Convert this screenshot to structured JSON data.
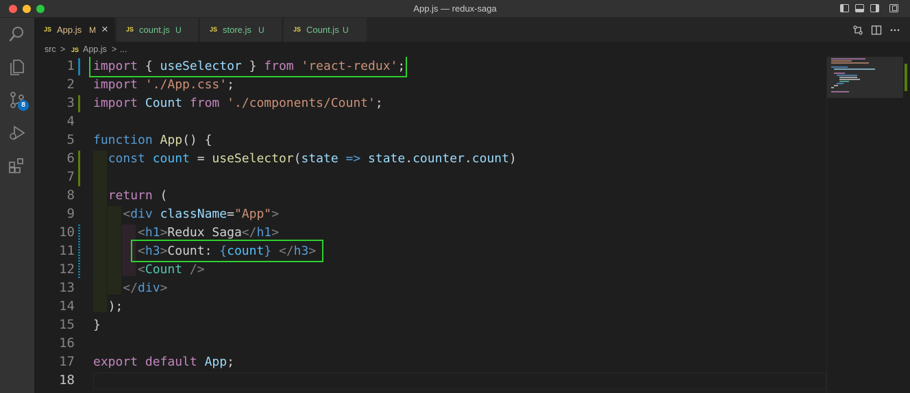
{
  "window": {
    "title": "App.js — redux-saga"
  },
  "tabs": [
    {
      "name": "App.js",
      "badge": "M",
      "close": "×"
    },
    {
      "name": "count.js",
      "badge": "U"
    },
    {
      "name": "store.js",
      "badge": "U"
    },
    {
      "name": "Count.js",
      "badge": "U"
    }
  ],
  "tab_icon_text": "JS",
  "activity": {
    "source_control_badge": "8"
  },
  "breadcrumbs": {
    "folder": "src",
    "sep": ">",
    "file": "App.js",
    "more": "..."
  },
  "editor": {
    "line_numbers": [
      "1",
      "2",
      "3",
      "4",
      "5",
      "6",
      "7",
      "8",
      "9",
      "10",
      "11",
      "12",
      "13",
      "14",
      "15",
      "16",
      "17",
      "18"
    ],
    "code": {
      "l1": {
        "import": "import",
        "brace_open": " { ",
        "ident": "useSelector",
        "brace_close": " } ",
        "from": "from",
        "space": " ",
        "module": "'react-redux'",
        "semi": ";"
      },
      "l2": {
        "import": "import",
        "space": " ",
        "module": "'./App.css'",
        "semi": ";"
      },
      "l3": {
        "import": "import",
        "space1": " ",
        "ident": "Count",
        "space2": " ",
        "from": "from",
        "space3": " ",
        "module": "'./components/Count'",
        "semi": ";"
      },
      "l5": {
        "function": "function",
        "space": " ",
        "name": "App",
        "rest": "() {"
      },
      "l6": {
        "indent": "  ",
        "const": "const",
        "space1": " ",
        "var": "count",
        "eq": " = ",
        "fn": "useSelector",
        "p1": "(",
        "param": "state",
        "arrow": " => ",
        "obj": "state",
        "dot1": ".",
        "prop1": "counter",
        "dot2": ".",
        "prop2": "count",
        "p2": ")"
      },
      "l8": {
        "indent": "  ",
        "return": "return",
        "rest": " ("
      },
      "l9": {
        "indent": "    ",
        "lt": "<",
        "tag": "div",
        "space": " ",
        "attr": "className",
        "eq": "=",
        "val": "\"App\"",
        "gt": ">"
      },
      "l10": {
        "indent": "      ",
        "lt": "<",
        "tag": "h1",
        "gt": ">",
        "text": "Redux Saga",
        "lt2": "</",
        "tag2": "h1",
        "gt2": ">"
      },
      "l11": {
        "indent": "      ",
        "lt": "<",
        "tag": "h3",
        "gt": ">",
        "text": "Count: ",
        "expr_open": "{",
        "expr": "count",
        "expr_close": "}",
        "space": " ",
        "lt2": "</",
        "tag2": "h3",
        "gt2": ">"
      },
      "l12": {
        "indent": "      ",
        "lt": "<",
        "tag": "Count",
        "rest": " />"
      },
      "l13": {
        "indent": "    ",
        "lt": "</",
        "tag": "div",
        "gt": ">"
      },
      "l14": {
        "indent": "  ",
        "text": ");"
      },
      "l15": {
        "text": "}"
      },
      "l17": {
        "export": "export",
        "space1": " ",
        "default": "default",
        "space2": " ",
        "name": "App",
        "semi": ";"
      }
    }
  },
  "colors": {
    "highlight_box": "#2fd02f",
    "keyword": "#c586c0",
    "string": "#ce9178",
    "function": "#dcdcaa",
    "variable": "#9cdcfe",
    "component": "#4ec9b0",
    "git_added": "#587c0c",
    "git_modified": "#1b81a8"
  }
}
